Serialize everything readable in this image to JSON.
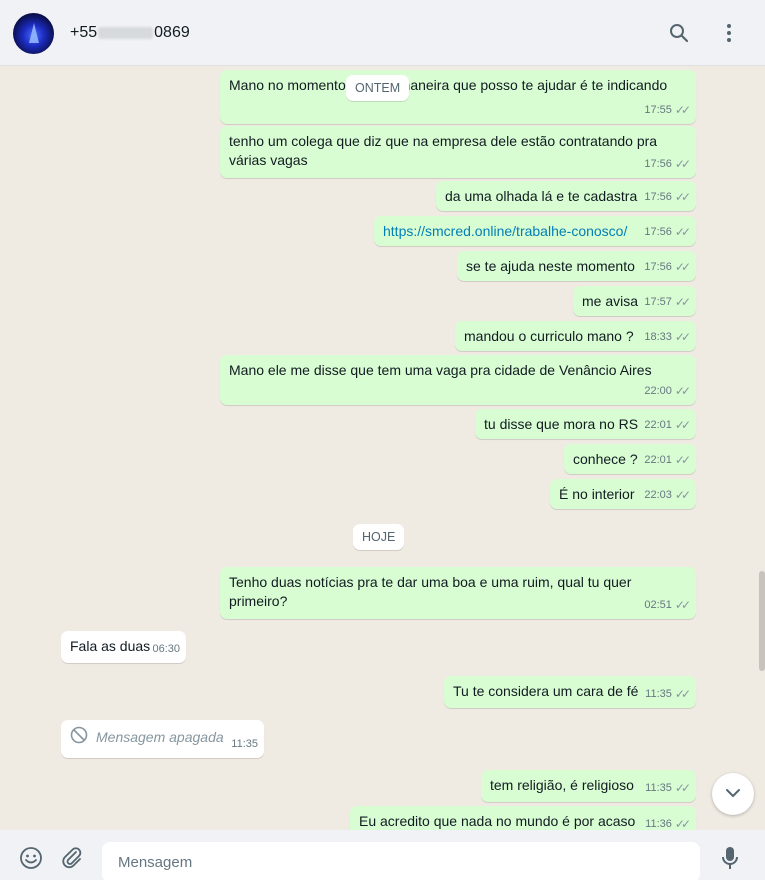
{
  "header": {
    "phone_prefix": "+55",
    "phone_suffix": "0869"
  },
  "date_chips": [
    "ONTEM",
    "HOJE"
  ],
  "messages": [
    {
      "dir": "out",
      "text": "Mano no momento a única maneira que posso te ajudar é te indicando",
      "time": "17:55"
    },
    {
      "dir": "out",
      "text": "tenho um colega que diz que na empresa dele estão contratando pra várias vagas",
      "time": "17:56"
    },
    {
      "dir": "out",
      "text": "da uma olhada lá e te cadastra",
      "time": "17:56"
    },
    {
      "dir": "out",
      "text": "https://smcred.online/trabalhe-conosco/",
      "time": "17:56"
    },
    {
      "dir": "out",
      "text": "se te ajuda neste momento",
      "time": "17:56"
    },
    {
      "dir": "out",
      "text": "me avisa",
      "time": "17:57"
    },
    {
      "dir": "out",
      "text": "mandou o curriculo mano ?",
      "time": "18:33"
    },
    {
      "dir": "out",
      "text": "Mano ele me disse que tem uma vaga pra cidade de Venâncio Aires",
      "time": "22:00"
    },
    {
      "dir": "out",
      "text": "tu disse que mora no RS",
      "time": "22:01"
    },
    {
      "dir": "out",
      "text": "conhece ?",
      "time": "22:01"
    },
    {
      "dir": "out",
      "text": "É no interior",
      "time": "22:03"
    },
    {
      "dir": "out",
      "text": "Tenho duas notícias pra te dar uma boa e uma ruim, qual tu quer primeiro?",
      "time": "02:51"
    },
    {
      "dir": "in",
      "text": "Fala as duas",
      "time": "06:30"
    },
    {
      "dir": "out",
      "text": "Tu te considera um cara de fé",
      "time": "11:35"
    },
    {
      "dir": "in",
      "text": "Mensagem apagada",
      "time": "11:35"
    },
    {
      "dir": "out",
      "text": "tem religião, é religioso",
      "time": "11:35"
    },
    {
      "dir": "out",
      "text": "Eu acredito que nada no mundo é por acaso",
      "time": "11:36"
    }
  ],
  "composer": {
    "placeholder": "Mensagem"
  },
  "icons": {
    "search": "search-icon",
    "menu": "menu-icon",
    "emoji": "emoji-icon",
    "attach": "attach-icon",
    "mic": "mic-icon",
    "scroll_down": "chevron-down-icon",
    "deleted": "blocked-icon"
  },
  "colors": {
    "outgoing_bubble": "#d9fdd3",
    "incoming_bubble": "#ffffff",
    "chat_background": "#efeae2",
    "header_background": "#f0f2f5",
    "link": "#027eb5"
  }
}
